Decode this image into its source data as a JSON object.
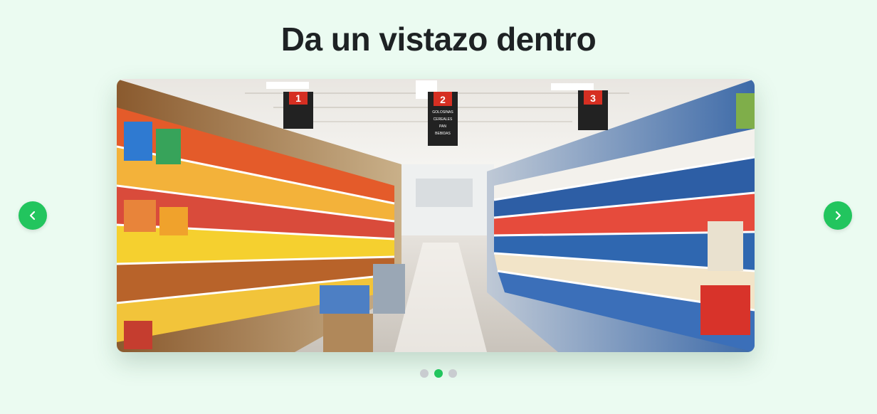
{
  "section": {
    "title": "Da un vistazo dentro"
  },
  "carousel": {
    "prev_icon": "chevron-left-icon",
    "next_icon": "chevron-right-icon",
    "slide": {
      "aisle_signs": [
        "1",
        "2",
        "3"
      ],
      "sign_lines": [
        "GOLOSINAS",
        "CEREALES",
        "PAN",
        "BEBIDAS"
      ]
    },
    "dots": [
      {
        "active": false
      },
      {
        "active": true
      },
      {
        "active": false
      }
    ]
  },
  "colors": {
    "accent": "#22c55e",
    "background": "#ebfbf1",
    "title": "#1e2224",
    "dot_inactive": "#c9ccd0"
  }
}
